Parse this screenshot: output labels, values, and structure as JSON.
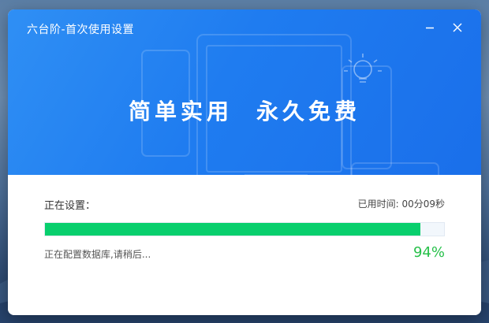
{
  "window": {
    "title": "六台阶-首次使用设置"
  },
  "banner": {
    "slogan_left": "简单实用",
    "slogan_right": "永久免费"
  },
  "setup": {
    "status_label": "正在设置：",
    "elapsed_label": "已用时间: ",
    "elapsed_value": "00分09秒",
    "progress_fraction": 0.94,
    "detail_text": "正在配置数据库,请稍后...",
    "percent_text": "94%"
  },
  "icons": {
    "minimize": "minimize-icon",
    "close": "close-icon",
    "lightbulb": "lightbulb-icon"
  },
  "colors": {
    "banner_blue": "#1f7cf0",
    "progress_green": "#08cf6d",
    "percent_green": "#27c04a"
  }
}
